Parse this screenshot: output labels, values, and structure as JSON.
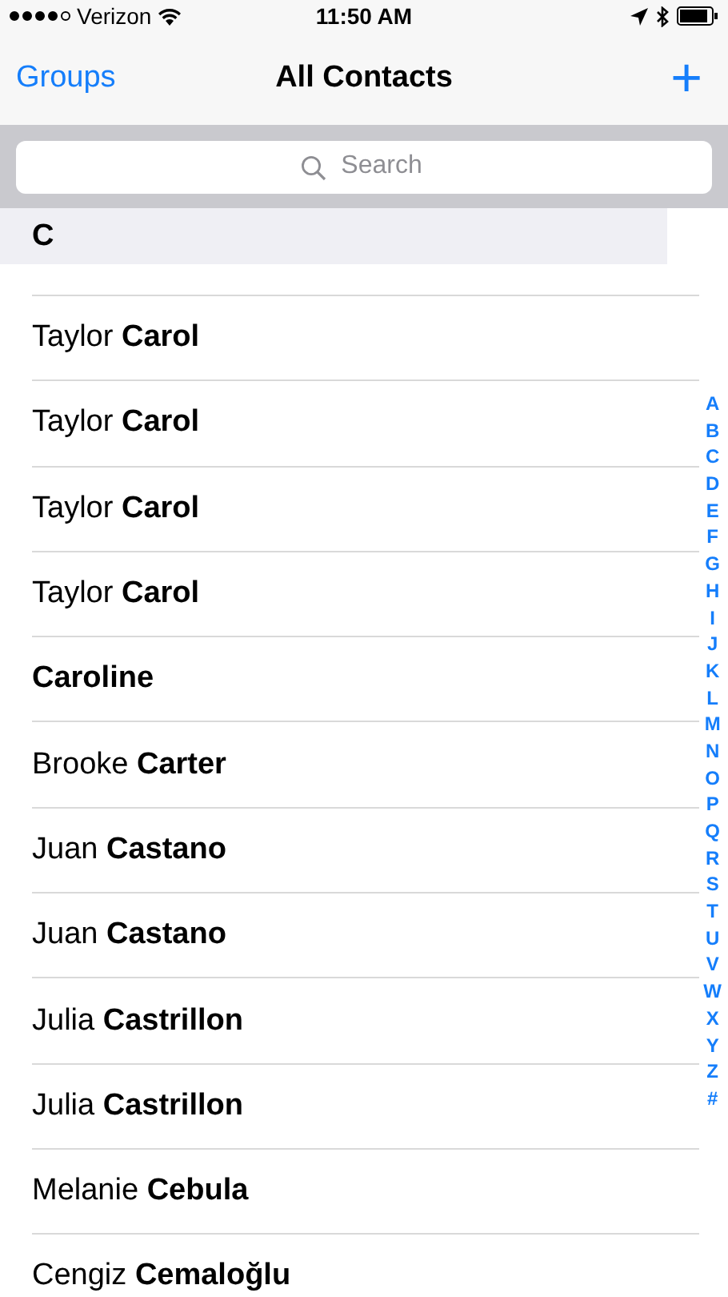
{
  "status_bar": {
    "carrier": "Verizon",
    "time": "11:50 AM"
  },
  "nav_bar": {
    "left_button": "Groups",
    "title": "All Contacts",
    "right_button": "+"
  },
  "search": {
    "placeholder": "Search"
  },
  "section": {
    "header": "C",
    "contacts": [
      {
        "first": "Taylor",
        "last": "Carol"
      },
      {
        "first": "Taylor",
        "last": "Carol"
      },
      {
        "first": "Taylor",
        "last": "Carol"
      },
      {
        "first": "Taylor",
        "last": "Carol"
      },
      {
        "last": "Caroline"
      },
      {
        "first": "Brooke",
        "last": "Carter"
      },
      {
        "first": "Juan",
        "last": "Castano"
      },
      {
        "first": "Juan",
        "last": "Castano"
      },
      {
        "first": "Julia",
        "last": "Castrillon"
      },
      {
        "first": "Julia",
        "last": "Castrillon"
      },
      {
        "first": "Melanie",
        "last": "Cebula"
      },
      {
        "first": "Cengiz",
        "last": "Cemaloğlu"
      }
    ]
  },
  "index": [
    "A",
    "B",
    "C",
    "D",
    "E",
    "F",
    "G",
    "H",
    "I",
    "J",
    "K",
    "L",
    "M",
    "N",
    "O",
    "P",
    "Q",
    "R",
    "S",
    "T",
    "U",
    "V",
    "W",
    "X",
    "Y",
    "Z",
    "#"
  ]
}
